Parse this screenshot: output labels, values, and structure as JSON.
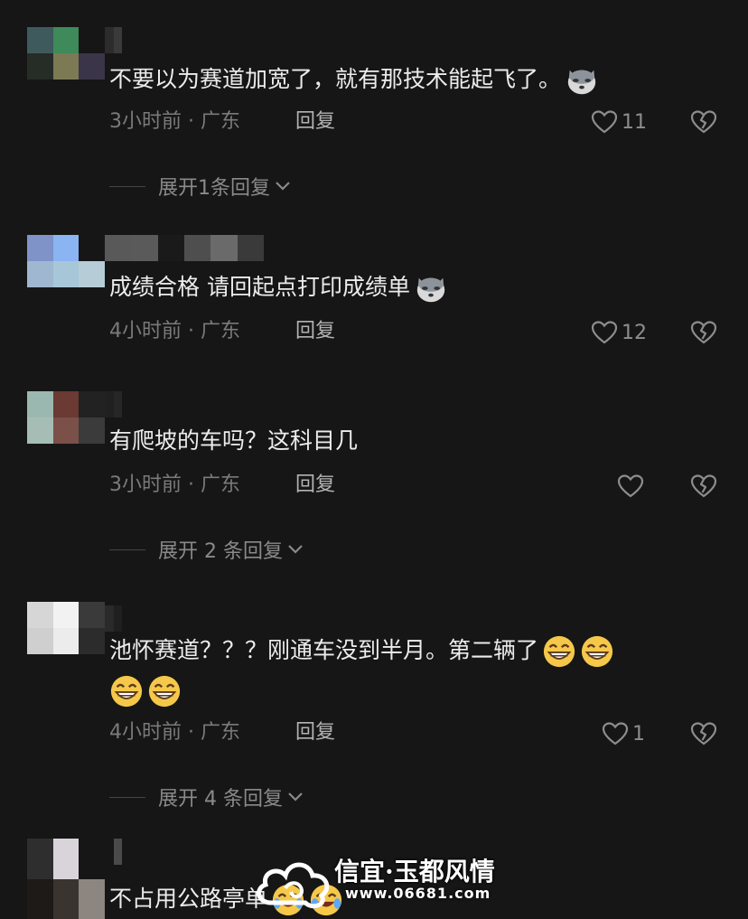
{
  "comments": [
    {
      "text": "不要以为赛道加宽了，就有那技术能起飞了。",
      "time": "3小时前",
      "location": "广东",
      "reply_label": "回复",
      "likes": "11",
      "expand": "展开1条回复",
      "emoji": "wolf-emoji"
    },
    {
      "text": "成绩合格 请回起点打印成绩单",
      "time": "4小时前",
      "location": "广东",
      "reply_label": "回复",
      "likes": "12",
      "emoji": "wolf-emoji"
    },
    {
      "text": "有爬坡的车吗？这科目几",
      "time": "3小时前",
      "location": "广东",
      "reply_label": "回复",
      "likes": "",
      "expand": "展开 2 条回复"
    },
    {
      "text_line1": "池怀赛道？？？刚通车没到半月。第二辆了",
      "time": "4小时前",
      "location": "广东",
      "reply_label": "回复",
      "likes": "1",
      "expand": "展开 4 条回复",
      "emoji": "grin-emoji"
    },
    {
      "text": "不占用公路亭单",
      "emoji": "laugh-cry-emoji"
    }
  ],
  "meta_separator": " · ",
  "watermark": {
    "title": "信宜·玉都风情",
    "url": "www.06681.com"
  },
  "colors": {
    "background": "#161616",
    "text": "#ececec",
    "meta": "#7a7a7a"
  }
}
